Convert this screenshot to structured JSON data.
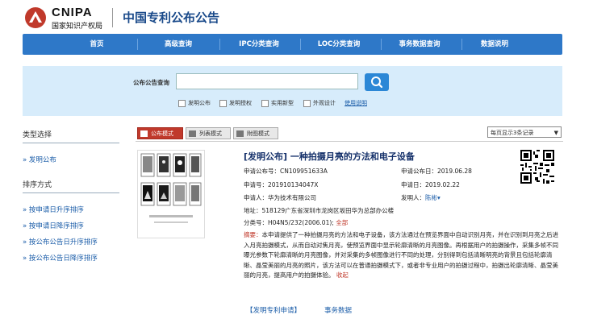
{
  "header": {
    "logo_en": "CNIPA",
    "logo_cn": "国家知识产权局",
    "site_title": "中国专利公布公告"
  },
  "nav": {
    "items": [
      "首页",
      "高级查询",
      "IPC分类查询",
      "LOC分类查询",
      "事务数据查询",
      "数据说明"
    ]
  },
  "search": {
    "label": "公布公告查询",
    "value": "",
    "options": [
      "发明公布",
      "发明授权",
      "实用新型",
      "外观设计"
    ],
    "help": "使用说明"
  },
  "sidebar": {
    "type_heading": "类型选择",
    "type_items": [
      "发明公布"
    ],
    "sort_heading": "排序方式",
    "sort_items": [
      "按申请日升序排序",
      "按申请日降序排序",
      "按公布公告日升序排序",
      "按公布公告日降序排序"
    ]
  },
  "view": {
    "tabs": [
      "公布模式",
      "列表模式",
      "附图模式"
    ],
    "active_tab": "公布模式",
    "per_page": "每页显示3条记录"
  },
  "record": {
    "title": "[发明公布] 一种拍摄月亮的方法和电子设备",
    "pub_no_label": "申请公布号：",
    "pub_no": "CN109951633A",
    "pub_date_label": "申请公布日：",
    "pub_date": "2019.06.28",
    "app_no_label": "申请号：",
    "app_no": "201910134047X",
    "app_date_label": "申请日：",
    "app_date": "2019.02.22",
    "applicant_label": "申请人：",
    "applicant": "华为技术有限公司",
    "inventor_label": "发明人：",
    "inventor": "陈彬",
    "address_label": "地址：",
    "address": "518129广东省深圳市龙岗区坂田华为总部办公楼",
    "class_label": "分类号：",
    "class_no": "H04N5/232(2006.01);",
    "class_all": "全部",
    "abstract_label": "摘要：",
    "abstract": "本申请提供了一种拍摄月亮的方法和电子设备，该方法通过在预览界面中自动识别月亮，并在识别到月亮之后进入月亮拍摄模式，从而自动对焦月亮，使预览界面中显示轮廓清晰的月亮图像。再根据用户的拍摄操作，采集多帧不同曝光参数下轮廓清晰的月亮图像，并对采集的多帧图像进行不同的处理，分别得到包括清晰明亮的背景且包括轮廓清晰、晶莹美丽的月亮的照片，该方法可以在普通拍摄模式下，或者非专业用户的拍摄过程中，拍摄出轮廓清晰、晶莹美丽的月亮，提高用户的拍摄体验。",
    "collapse": "收起",
    "link_app": "【发明专利申请】",
    "link_affairs": "事务数据"
  }
}
